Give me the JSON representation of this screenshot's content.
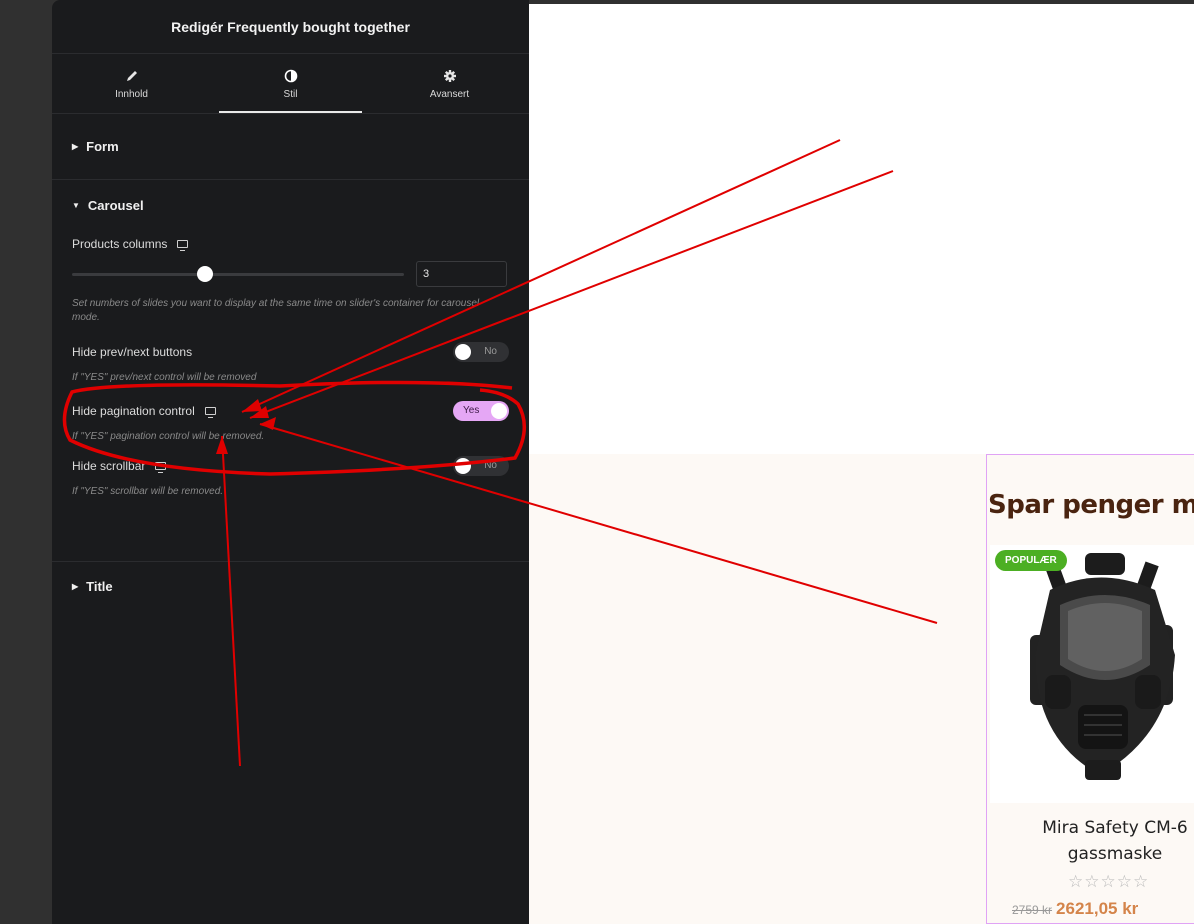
{
  "panel": {
    "title": "Redigér Frequently bought together",
    "tabs": [
      {
        "label": "Innhold",
        "icon": "pencil-icon"
      },
      {
        "label": "Stil",
        "icon": "contrast-icon"
      },
      {
        "label": "Avansert",
        "icon": "gear-icon"
      }
    ],
    "active_tab": "Stil",
    "sections": {
      "form": "Form",
      "carousel": "Carousel",
      "title": "Title"
    },
    "controls": {
      "products_columns": {
        "label": "Products columns",
        "value": "3",
        "slider_fraction": 0.4,
        "hint": "Set numbers of slides you want to display at the same time on slider's container for carousel mode."
      },
      "hide_prev_next": {
        "label": "Hide prev/next buttons",
        "state": "No",
        "hint": "If \"YES\" prev/next control will be removed"
      },
      "hide_pagination": {
        "label": "Hide pagination control",
        "state": "Yes",
        "hint": "If \"YES\" pagination control will be removed."
      },
      "hide_scrollbar": {
        "label": "Hide scrollbar",
        "state": "No",
        "hint": "If \"YES\" scrollbar will be removed."
      }
    }
  },
  "preview": {
    "heading": "Spar penger m",
    "badge": "POPULÆR",
    "product_name_line1": "Mira Safety CM-6",
    "product_name_line2": "gassmaske",
    "stars": "☆☆☆☆☆",
    "old_price": "2759 kr",
    "new_price": "2621,05 kr"
  },
  "colors": {
    "panel_bg": "#1a1b1d",
    "toggle_on": "#e5a7f5",
    "annotation": "#e00000",
    "badge": "#4caf23",
    "price": "#d4844a",
    "heading": "#4a2410"
  }
}
